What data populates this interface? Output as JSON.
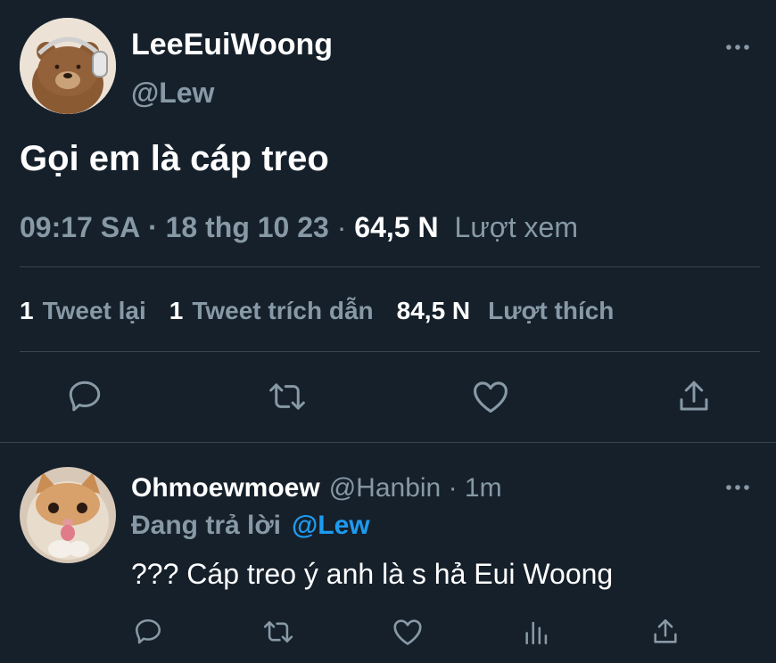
{
  "tweet": {
    "display_name": "LeeEuiWoong",
    "handle": "@Lew",
    "text": "Gọi em là cáp treo",
    "time": "09:17 SA",
    "date": "18 thg 10 23",
    "views_count": "64,5 N",
    "views_label": "Lượt xem",
    "retweets_count": "1",
    "retweets_label": "Tweet lại",
    "quotes_count": "1",
    "quotes_label": "Tweet trích dẫn",
    "likes_count": "84,5 N",
    "likes_label": "Lượt thích"
  },
  "reply": {
    "display_name": "Ohmoewmoew",
    "handle": "@Hanbin",
    "time": "1m",
    "replying_label": "Đang trả lời",
    "replying_to": "@Lew",
    "text": "??? Cáp treo ý anh là s hả Eui Woong"
  },
  "icons": {
    "more": "more-icon",
    "reply": "reply-icon",
    "retweet": "retweet-icon",
    "like": "heart-icon",
    "share": "share-icon",
    "analytics": "analytics-icon"
  },
  "colors": {
    "background": "#15202b",
    "text": "#ffffff",
    "muted": "#8899a6",
    "link": "#1d9bf0",
    "divider": "#38444d"
  }
}
